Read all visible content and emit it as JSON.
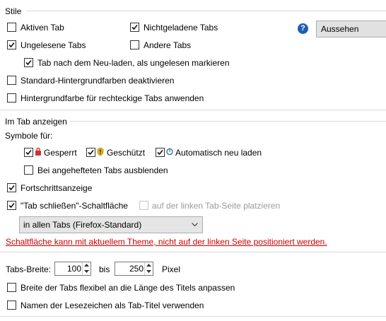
{
  "style_section": {
    "title": "Stile",
    "active_tab": {
      "label": "Aktiven Tab",
      "checked": false
    },
    "unloaded_tabs": {
      "label": "Nichtgeladene Tabs",
      "checked": true
    },
    "unread_tabs": {
      "label": "Ungelesene Tabs",
      "checked": true
    },
    "other_tabs": {
      "label": "Andere Tabs",
      "checked": false
    },
    "mark_unread_after_reload": {
      "label": "Tab nach dem Neu-laden, als ungelesen markieren",
      "checked": true
    },
    "disable_default_bg": {
      "label": "Standard-Hintergrundfarben deaktivieren",
      "checked": false
    },
    "bg_rect_tabs": {
      "label": "Hintergrundfarbe für rechteckige Tabs anwenden",
      "checked": false
    },
    "customize_button": "Aussehen anpassen"
  },
  "tab_display_section": {
    "title": "Im Tab anzeigen",
    "icons_for_label": "Symbole für:",
    "locked": {
      "label": "Gesperrt",
      "checked": true
    },
    "protected": {
      "label": "Geschützt",
      "checked": true
    },
    "auto_reload": {
      "label": "Automatisch neu laden",
      "checked": true
    },
    "hide_on_pinned": {
      "label": "Bei angehefteten Tabs ausblenden",
      "checked": false
    },
    "progress": {
      "label": "Fortschrittsanzeige",
      "checked": true
    },
    "close_button": {
      "label": "\"Tab schließen\"-Schaltfläche",
      "checked": true
    },
    "left_side": {
      "label": "auf der linken Tab-Seite platzieren",
      "checked": false,
      "disabled": true
    },
    "close_button_mode": "in allen Tabs (Firefox-Standard)",
    "warning": "Schaltfläche kann mit aktuellem Theme, nicht auf der linken Seite positioniert werden."
  },
  "width_section": {
    "label": "Tabs-Breite:",
    "min": "100",
    "between": "bis",
    "max": "250",
    "unit": "Pixel",
    "flex_width": {
      "label": "Breite der Tabs flexibel an die Länge des Titels anpassen",
      "checked": false
    },
    "bookmark_titles": {
      "label": "Namen der Lesezeichen als Tab-Titel verwenden",
      "checked": false
    }
  },
  "colors": {
    "warning": "#cc0000",
    "help_icon": "#1e5fb4"
  }
}
